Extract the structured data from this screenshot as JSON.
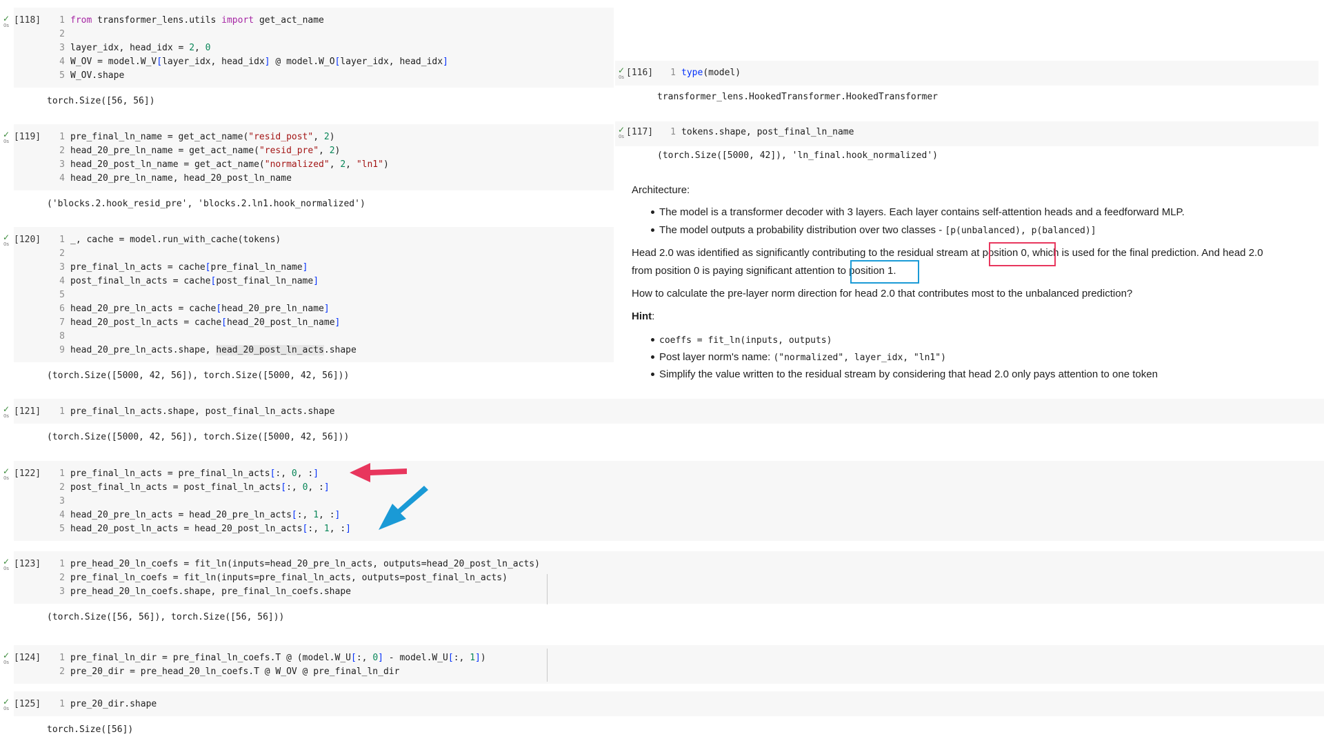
{
  "cells": {
    "c118": {
      "prompt": "[118]",
      "lines": [
        "from transformer_lens.utils import get_act_name",
        "",
        "layer_idx, head_idx = 2, 0",
        "W_OV = model.W_V[layer_idx, head_idx] @ model.W_O[layer_idx, head_idx]",
        "W_OV.shape"
      ],
      "output": "torch.Size([56, 56])"
    },
    "c119": {
      "prompt": "[119]",
      "lines": [
        "pre_final_ln_name = get_act_name(\"resid_post\", 2)",
        "head_20_pre_ln_name = get_act_name(\"resid_pre\", 2)",
        "head_20_post_ln_name = get_act_name(\"normalized\", 2, \"ln1\")",
        "head_20_pre_ln_name, head_20_post_ln_name"
      ],
      "output": "('blocks.2.hook_resid_pre', 'blocks.2.ln1.hook_normalized')"
    },
    "c120": {
      "prompt": "[120]",
      "lines": [
        "_, cache = model.run_with_cache(tokens)",
        "",
        "pre_final_ln_acts = cache[pre_final_ln_name]",
        "post_final_ln_acts = cache[post_final_ln_name]",
        "",
        "head_20_pre_ln_acts = cache[head_20_pre_ln_name]",
        "head_20_post_ln_acts = cache[head_20_post_ln_name]",
        "",
        "head_20_pre_ln_acts.shape, head_20_post_ln_acts.shape"
      ],
      "output": "(torch.Size([5000, 42, 56]), torch.Size([5000, 42, 56]))"
    },
    "c121": {
      "prompt": "[121]",
      "lines": [
        "pre_final_ln_acts.shape, post_final_ln_acts.shape"
      ],
      "output": "(torch.Size([5000, 42, 56]), torch.Size([5000, 42, 56]))"
    },
    "c122": {
      "prompt": "[122]",
      "lines": [
        "pre_final_ln_acts = pre_final_ln_acts[:, 0, :]",
        "post_final_ln_acts = post_final_ln_acts[:, 0, :]",
        "",
        "head_20_pre_ln_acts = head_20_pre_ln_acts[:, 1, :]",
        "head_20_post_ln_acts = head_20_post_ln_acts[:, 1, :]"
      ]
    },
    "c123": {
      "prompt": "[123]",
      "lines": [
        "pre_head_20_ln_coefs = fit_ln(inputs=head_20_pre_ln_acts, outputs=head_20_post_ln_acts)",
        "pre_final_ln_coefs = fit_ln(inputs=pre_final_ln_acts, outputs=post_final_ln_acts)",
        "pre_head_20_ln_coefs.shape, pre_final_ln_coefs.shape"
      ],
      "output": "(torch.Size([56, 56]), torch.Size([56, 56]))"
    },
    "c124": {
      "prompt": "[124]",
      "lines": [
        "pre_final_ln_dir = pre_final_ln_coefs.T @ (model.W_U[:, 0] - model.W_U[:, 1])",
        "pre_20_dir = pre_head_20_ln_coefs.T @ W_OV @ pre_final_ln_dir"
      ]
    },
    "c125": {
      "prompt": "[125]",
      "lines": [
        "pre_20_dir.shape"
      ],
      "output": "torch.Size([56])"
    },
    "c116": {
      "prompt": "[116]",
      "lines": [
        "type(model)"
      ],
      "output": "transformer_lens.HookedTransformer.HookedTransformer"
    },
    "c117": {
      "prompt": "[117]",
      "lines": [
        "tokens.shape, post_final_ln_name"
      ],
      "output": "(torch.Size([5000, 42]), 'ln_final.hook_normalized')"
    }
  },
  "status": {
    "check": "✓",
    "time": "0s"
  },
  "markdown": {
    "heading": "Architecture:",
    "bullet1": "The model is a transformer decoder with 3 layers. Each layer contains self-attention heads and a feedforward MLP.",
    "bullet2_text": "The model outputs a probability distribution over two classes - ",
    "bullet2_code": "[p(unbalanced), p(balanced)]",
    "para1_a": "Head 2.0 was identified as significantly contributing to the residual stream ",
    "para1_hl1": "at position 0",
    "para1_b": ", which is used for the final prediction. And head 2.0",
    "para1_c": "from position 0 is paying significant attention ",
    "para1_hl2": "to position 1",
    "para1_d": ".",
    "question": "How to calculate the pre-layer norm direction for head 2.0 that contributes most to the unbalanced prediction?",
    "hint_label": "Hint",
    "hint_colon": ":",
    "hint1_code": "coeffs = fit_ln(inputs, outputs)",
    "hint2_text": "Post layer norm's name: ",
    "hint2_code": "(\"normalized\", layer_idx, \"ln1\")",
    "hint3": "Simplify the value written to the residual stream by considering that head 2.0 only pays attention to one token"
  },
  "colors": {
    "red_highlight": "#e8365d",
    "blue_highlight": "#1a9ad6"
  }
}
